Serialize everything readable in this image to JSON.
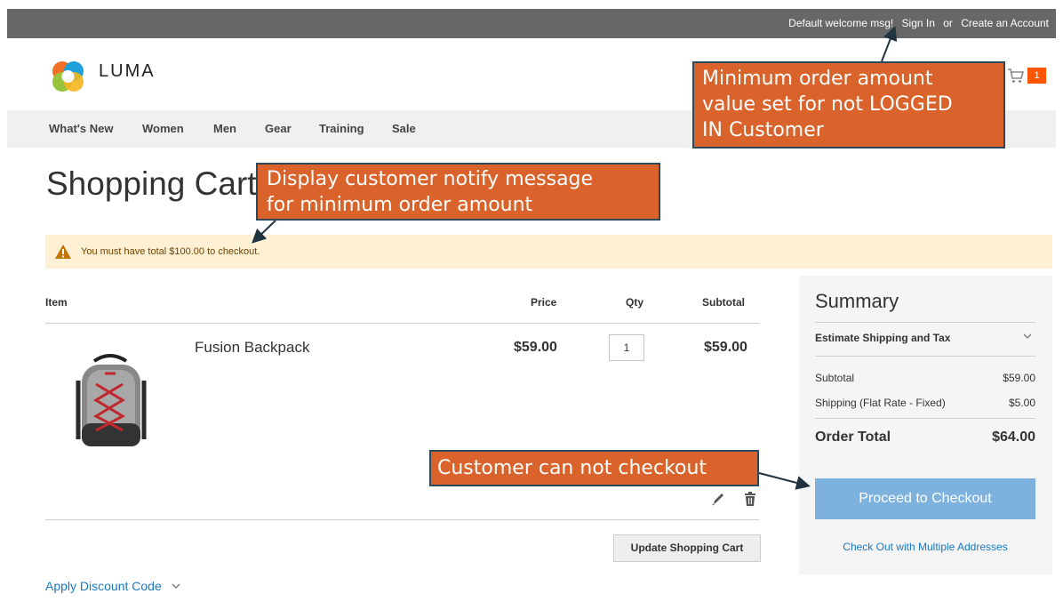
{
  "header": {
    "welcome": "Default welcome msg!",
    "sign_in": "Sign In",
    "or": "or",
    "create_account": "Create an Account",
    "brand": "LUMA",
    "cart_count": "1"
  },
  "nav": {
    "items": [
      {
        "label": "What's New"
      },
      {
        "label": "Women"
      },
      {
        "label": "Men"
      },
      {
        "label": "Gear"
      },
      {
        "label": "Training"
      },
      {
        "label": "Sale"
      }
    ]
  },
  "page": {
    "title": "Shopping Cart",
    "notice": "You must have total $100.00 to checkout."
  },
  "cart": {
    "columns": {
      "item": "Item",
      "price": "Price",
      "qty": "Qty",
      "subtotal": "Subtotal"
    },
    "item": {
      "name": "Fusion Backpack",
      "price": "$59.00",
      "qty": "1",
      "subtotal": "$59.00"
    },
    "update_button": "Update Shopping Cart",
    "discount": "Apply Discount Code"
  },
  "summary": {
    "title": "Summary",
    "estimate": "Estimate Shipping and Tax",
    "subtotal_label": "Subtotal",
    "subtotal_value": "$59.00",
    "shipping_label": "Shipping (Flat Rate - Fixed)",
    "shipping_value": "$5.00",
    "total_label": "Order Total",
    "total_value": "$64.00",
    "checkout_button": "Proceed to Checkout",
    "multi_address": "Check Out with Multiple Addresses"
  },
  "annotations": {
    "minimum_amount_lines": [
      "Minimum order amount",
      "value set for not LOGGED",
      "IN Customer"
    ],
    "notify_lines": [
      "Display customer notify message",
      "for minimum order amount"
    ],
    "cannot_checkout": "Customer can not checkout"
  },
  "colors": {
    "accent_orange": "#ff5501",
    "callout": "#d9632b",
    "link": "#1979c3",
    "checkout_disabled": "#7db2df",
    "notice_bg": "#fdf0d5"
  },
  "icons": {
    "logo": "luma-logo-icon",
    "cart": "cart-icon",
    "warning": "warning-icon",
    "edit": "pencil-icon",
    "delete": "trash-icon",
    "chevron": "chevron-down-icon"
  }
}
